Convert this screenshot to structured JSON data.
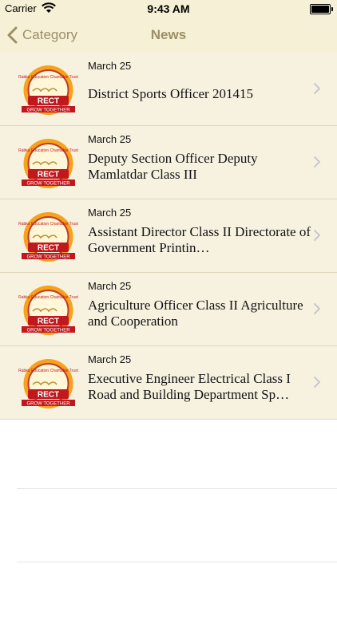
{
  "status": {
    "carrier": "Carrier",
    "time": "9:43 AM"
  },
  "nav": {
    "back_label": "Category",
    "title": "News"
  },
  "items": [
    {
      "date": "March 25",
      "title": "District Sports Officer 201415"
    },
    {
      "date": "March 25",
      "title": "Deputy Section Officer Deputy Mamlatdar Class III"
    },
    {
      "date": "March 25",
      "title": "Assistant Director Class II Directorate of Government Printin…"
    },
    {
      "date": "March 25",
      "title": "Agriculture Officer Class II Agriculture and Cooperation"
    },
    {
      "date": "March 25",
      "title": "Executive Engineer Electrical Class I Road and Building Department Sp…"
    }
  ],
  "logo": {
    "text_top": "Rabka Education Charitable Trust",
    "text_main": "RECT",
    "text_bottom": "GROW TOGETHER"
  },
  "colors": {
    "bar_bg": "#f6f0d6",
    "row_bg": "#f7f2e0",
    "accent": "#9b8f66"
  }
}
